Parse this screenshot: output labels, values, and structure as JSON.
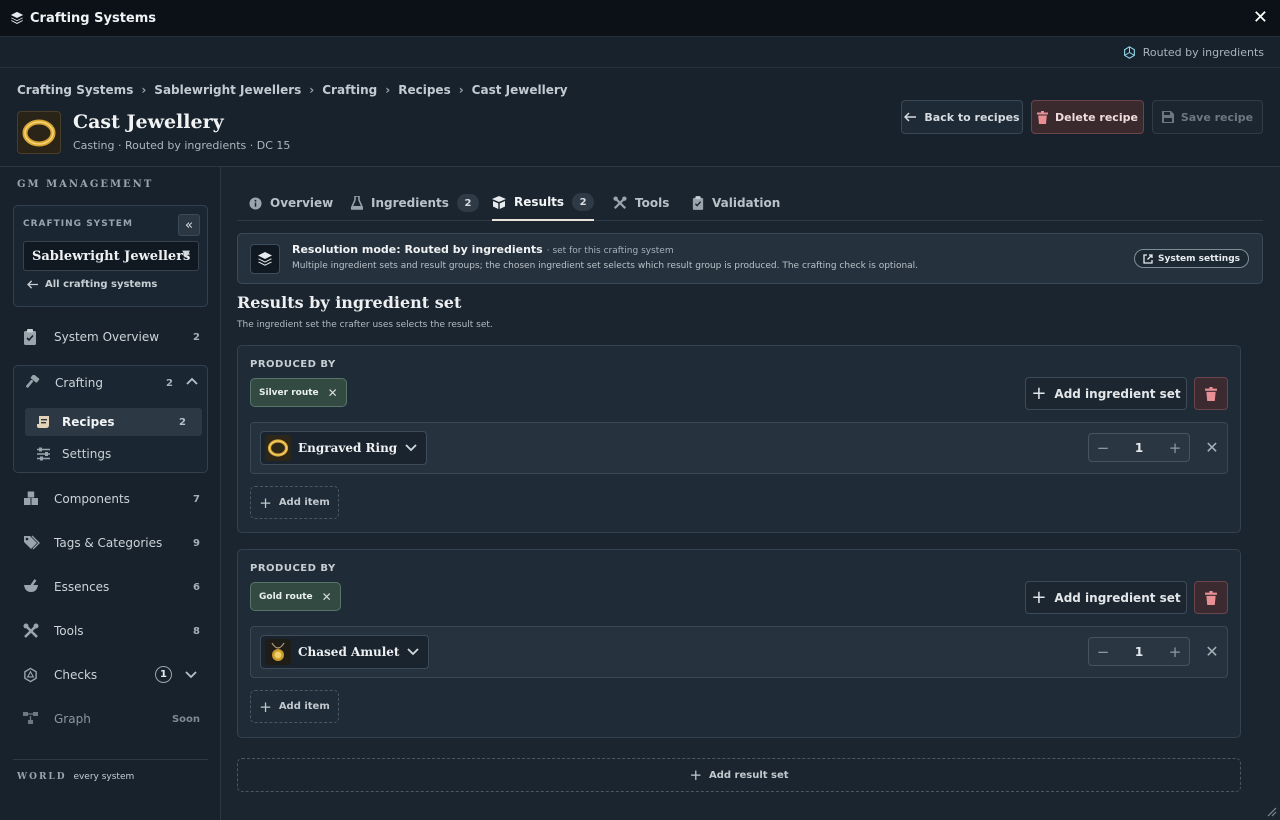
{
  "window": {
    "title": "Crafting Systems"
  },
  "info_strip": {
    "text": "Routed by ingredients"
  },
  "breadcrumb": [
    "Crafting Systems",
    "Sablewright Jewellers",
    "Crafting",
    "Recipes",
    "Cast Jewellery"
  ],
  "recipe": {
    "title": "Cast Jewellery",
    "subtitle": "Casting · Routed by ingredients · DC 15",
    "icon": "gold-ring-icon"
  },
  "header_actions": {
    "back": "Back to recipes",
    "delete": "Delete recipe",
    "save": "Save recipe"
  },
  "sidebar": {
    "section_label": "GM MANAGEMENT",
    "crafting_system_label": "CRAFTING SYSTEM",
    "selected_system": "Sablewright Jewellers",
    "all_systems_link": "All crafting systems",
    "items": [
      {
        "label": "System Overview",
        "count": "2",
        "icon": "clipboard-icon"
      },
      {
        "label": "Crafting",
        "count": "2",
        "icon": "hammer-icon"
      },
      {
        "label": "Components",
        "count": "7",
        "icon": "boxes-icon"
      },
      {
        "label": "Tags & Categories",
        "count": "9",
        "icon": "tags-icon"
      },
      {
        "label": "Essences",
        "count": "6",
        "icon": "mortar-icon"
      },
      {
        "label": "Tools",
        "count": "8",
        "icon": "tools-icon"
      },
      {
        "label": "Checks",
        "count": "1",
        "icon": "dice-icon"
      },
      {
        "label": "Graph",
        "count": "Soon",
        "icon": "graph-icon"
      }
    ],
    "sub_items": [
      {
        "label": "Recipes",
        "count": "2",
        "icon": "scroll-icon"
      },
      {
        "label": "Settings",
        "count": "",
        "icon": "sliders-icon"
      }
    ],
    "world_label": "WORLD",
    "world_value": "every system"
  },
  "tabs": [
    {
      "label": "Overview",
      "count": ""
    },
    {
      "label": "Ingredients",
      "count": "2"
    },
    {
      "label": "Results",
      "count": "2"
    },
    {
      "label": "Tools",
      "count": ""
    },
    {
      "label": "Validation",
      "count": ""
    }
  ],
  "active_tab": "Results",
  "mode_banner": {
    "title": "Resolution mode: Routed by ingredients",
    "note": "· set for this crafting system",
    "description": "Multiple ingredient sets and result groups; the chosen ingredient set selects which result group is produced. The crafting check is optional.",
    "button": "System settings"
  },
  "section": {
    "title": "Results by ingredient set",
    "subtitle": "The ingredient set the crafter uses selects the result set."
  },
  "groups": [
    {
      "produced_by_label": "PRODUCED BY",
      "route": "Silver route",
      "add_set_label": "Add ingredient set",
      "item": {
        "name": "Engraved Ring",
        "quantity": "1",
        "icon": "ring-icon"
      },
      "add_item_label": "Add item"
    },
    {
      "produced_by_label": "PRODUCED BY",
      "route": "Gold route",
      "add_set_label": "Add ingredient set",
      "item": {
        "name": "Chased Amulet",
        "quantity": "1",
        "icon": "amulet-icon"
      },
      "add_item_label": "Add item"
    }
  ],
  "add_result_label": "Add result set",
  "stepper": {
    "minus": "−",
    "plus": "+"
  },
  "colors": {
    "accent_gold": "#d9a531",
    "danger": "#e88f95",
    "route_chip": "#334a42"
  }
}
